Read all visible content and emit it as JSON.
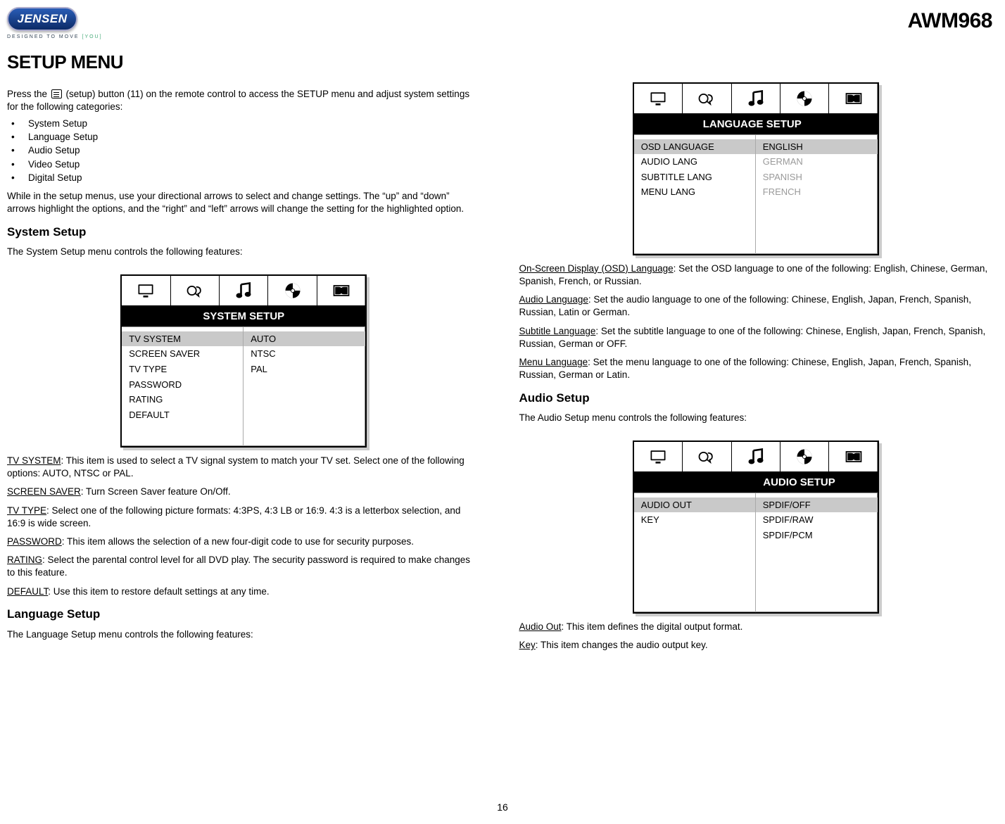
{
  "header": {
    "brand": "JENSEN",
    "tagline_a": "DESIGNED TO MOVE",
    "tagline_b": "[YOU]",
    "model": "AWM968"
  },
  "title": "SETUP MENU",
  "intro": {
    "before_icon": "Press the ",
    "after_icon": " (setup) button (11) on the remote control to access the SETUP menu and adjust system settings for the following categories:"
  },
  "categories": [
    "System Setup",
    "Language Setup",
    "Audio Setup",
    "Video Setup",
    "Digital Setup"
  ],
  "nav_text": "While in the setup menus, use your directional arrows to select and change settings. The “up” and “down” arrows highlight the options, and the “right” and “left” arrows will change the setting for the highlighted option.",
  "sections": {
    "system": {
      "heading": "System Setup",
      "lead": "The System Setup menu controls the following features:",
      "osd": {
        "title": "SYSTEM SETUP",
        "left": [
          "TV SYSTEM",
          "SCREEN SAVER",
          "TV TYPE",
          "PASSWORD",
          "RATING",
          "DEFAULT"
        ],
        "right": [
          "AUTO",
          "NTSC",
          "PAL"
        ],
        "selected_left_index": 0
      },
      "items": [
        {
          "label": "TV SYSTEM",
          "text": ": This item is used to select a TV signal system to match your TV set. Select one of the following options: AUTO, NTSC or PAL."
        },
        {
          "label": "SCREEN SAVER",
          "text": ": Turn Screen Saver feature On/Off."
        },
        {
          "label": "TV TYPE",
          "text": ": Select one of the following picture formats: 4:3PS, 4:3 LB or 16:9. 4:3 is a letterbox selection, and 16:9 is wide screen."
        },
        {
          "label": "PASSWORD",
          "text": ": This item allows the selection of a new four-digit code to use for security purposes."
        },
        {
          "label": "RATING",
          "text": ": Select the parental control level for all DVD play. The security password is required to make changes to this feature."
        },
        {
          "label": "DEFAULT",
          "text": ": Use this item to restore default settings at any time."
        }
      ]
    },
    "language": {
      "heading": "Language Setup",
      "lead": "The Language Setup menu controls the following features:",
      "osd": {
        "title": "LANGUAGE SETUP",
        "left": [
          "OSD LANGUAGE",
          "AUDIO LANG",
          "SUBTITLE LANG",
          "MENU LANG"
        ],
        "right": [
          "ENGLISH",
          "GERMAN",
          "SPANISH",
          "FRENCH"
        ],
        "selected_left_index": 0,
        "right_active_index": 0
      },
      "items": [
        {
          "label": "On-Screen Display (OSD) Language",
          "text": ": Set the OSD language to one of the following: English, Chinese, German, Spanish, French, or Russian."
        },
        {
          "label": "Audio Language",
          "text": ": Set the audio language to one of the following: Chinese, English, Japan, French, Spanish, Russian, Latin or German."
        },
        {
          "label": "Subtitle Language",
          "text": ": Set the subtitle language to one of the following: Chinese, English, Japan, French, Spanish, Russian, German or OFF."
        },
        {
          "label": "Menu Language",
          "text": ": Set the menu language to one of the following: Chinese, English, Japan, French, Spanish, Russian, German or Latin."
        }
      ]
    },
    "audio": {
      "heading": "Audio Setup",
      "lead": "The Audio Setup menu controls the following features:",
      "osd": {
        "title": "AUDIO SETUP",
        "left": [
          "AUDIO OUT",
          "KEY"
        ],
        "right": [
          "SPDIF/OFF",
          "SPDIF/RAW",
          "SPDIF/PCM"
        ],
        "selected_left_index": 0
      },
      "items": [
        {
          "label": "Audio Out",
          "text": ": This item defines the digital output format."
        },
        {
          "label": "Key",
          "text": ": This item changes the audio output key."
        }
      ]
    }
  },
  "page_number": "16",
  "icons": {
    "tab_tv": "tv-icon",
    "tab_language": "speech-bubble-icon",
    "tab_music": "music-note-icon",
    "tab_disc": "disc-icon",
    "tab_dolby": "dolby-icon"
  }
}
